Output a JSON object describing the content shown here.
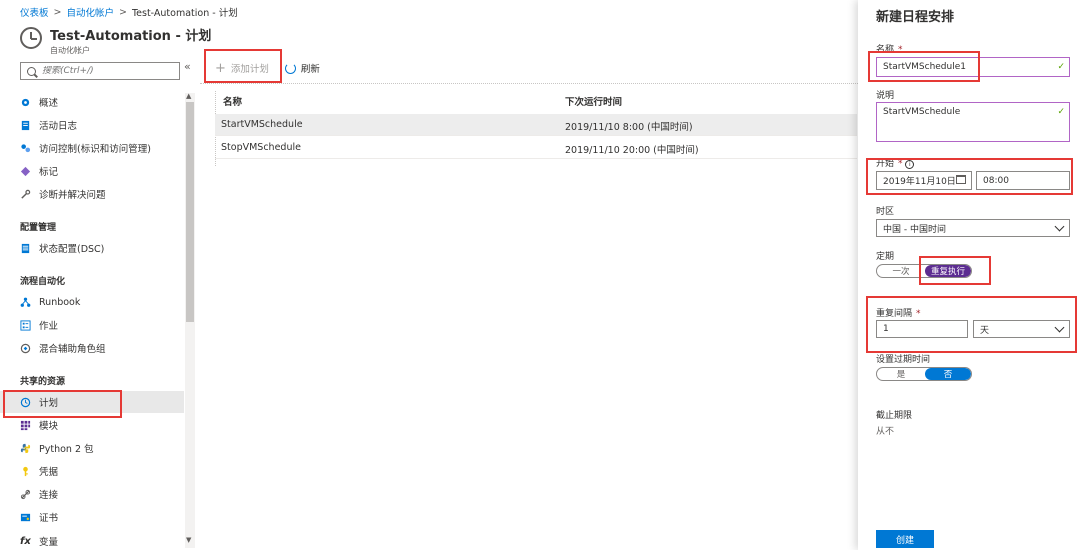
{
  "breadcrumb": {
    "items": [
      "仪表板",
      "自动化帐户",
      "Test-Automation - 计划"
    ]
  },
  "header": {
    "title": "Test-Automation - 计划",
    "subtitle": "自动化帐户"
  },
  "nav": {
    "search_placeholder": "搜索(Ctrl+/)",
    "collapse": "«",
    "items_top": [
      {
        "label": "概述",
        "icon": "overview-icon"
      },
      {
        "label": "活动日志",
        "icon": "activity-log-icon"
      },
      {
        "label": "访问控制(标识和访问管理)",
        "icon": "access-control-icon"
      },
      {
        "label": "标记",
        "icon": "tag-icon"
      },
      {
        "label": "诊断并解决问题",
        "icon": "wrench-icon"
      }
    ],
    "section_config": "配置管理",
    "items_config": [
      {
        "label": "状态配置(DSC)",
        "icon": "dsc-icon"
      }
    ],
    "section_process": "流程自动化",
    "items_process": [
      {
        "label": "Runbook",
        "icon": "runbook-icon"
      },
      {
        "label": "作业",
        "icon": "jobs-icon"
      },
      {
        "label": "混合辅助角色组",
        "icon": "hybrid-worker-icon"
      }
    ],
    "section_shared": "共享的资源",
    "items_shared": [
      {
        "label": "计划",
        "icon": "clock-icon"
      },
      {
        "label": "模块",
        "icon": "modules-icon"
      },
      {
        "label": "Python 2 包",
        "icon": "python-icon"
      },
      {
        "label": "凭据",
        "icon": "key-icon"
      },
      {
        "label": "连接",
        "icon": "connection-icon"
      },
      {
        "label": "证书",
        "icon": "certificate-icon"
      },
      {
        "label": "变量",
        "icon": "fx-icon"
      }
    ]
  },
  "toolbar": {
    "add_label": "添加计划",
    "refresh_label": "刷新"
  },
  "table": {
    "columns": [
      "名称",
      "下次运行时间"
    ],
    "rows": [
      [
        "StartVMSchedule",
        "2019/11/10 8:00 (中国时间)"
      ],
      [
        "StopVMSchedule",
        "2019/11/10 20:00 (中国时间)"
      ]
    ]
  },
  "panel": {
    "title": "新建日程安排",
    "name_label": "名称",
    "name_value": "StartVMSchedule1",
    "desc_label": "说明",
    "desc_value": "StartVMSchedule",
    "start_label": "开始",
    "start_date": "2019年11月10日",
    "start_time": "08:00",
    "tz_label": "时区",
    "tz_value": "中国 - 中国时间",
    "recur_label": "定期",
    "recur_once": "一次",
    "recur_repeat": "重复执行",
    "interval_label": "重复间隔",
    "interval_value": "1",
    "interval_unit": "天",
    "expire_label": "设置过期时间",
    "expire_yes": "是",
    "expire_no": "否",
    "deadline_label": "截止期限",
    "deadline_value": "从不",
    "create_label": "创建"
  },
  "colors": {
    "accent": "#0078d4",
    "purple": "#5c2d91",
    "highlight": "#e53935"
  }
}
